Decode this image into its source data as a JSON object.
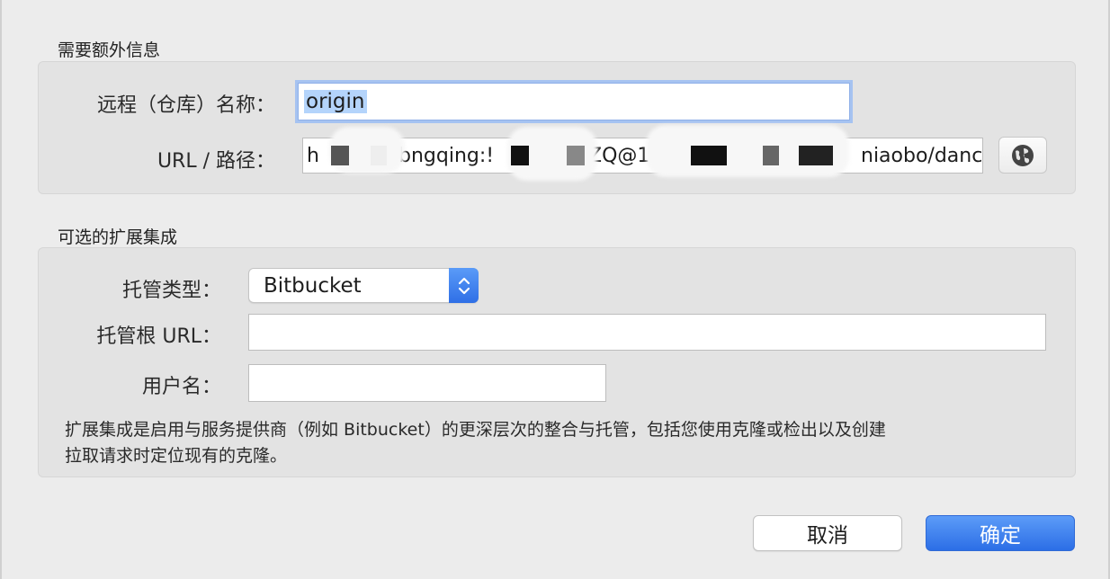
{
  "colors": {
    "accent": "#3478f6",
    "selection": "#b4d4fb",
    "focus_ring": "#a6c3f1",
    "panel": "#e3e3e3",
    "window": "#ececec"
  },
  "required": {
    "title": "需要额外信息",
    "remote_name_label": "远程（仓库）名称：",
    "remote_name_value": "origin",
    "url_label": "URL / 路径：",
    "url_segments": [
      "h",
      "bngqing:!",
      "ZQ@1",
      "niaobo/danc"
    ],
    "browse_icon": "globe-icon"
  },
  "optional": {
    "title": "可选的扩展集成",
    "hosting_type_label": "托管类型：",
    "hosting_type_value": "Bitbucket",
    "hosting_root_label": "托管根 URL：",
    "hosting_root_value": "",
    "username_label": "用户名：",
    "username_value": "",
    "help_line_1": "扩展集成是启用与服务提供商（例如 Bitbucket）的更深层次的整合与托管，包括您使用克隆或检出以及创建",
    "help_line_2": "拉取请求时定位现有的克隆。"
  },
  "buttons": {
    "cancel": "取消",
    "ok": "确定"
  }
}
